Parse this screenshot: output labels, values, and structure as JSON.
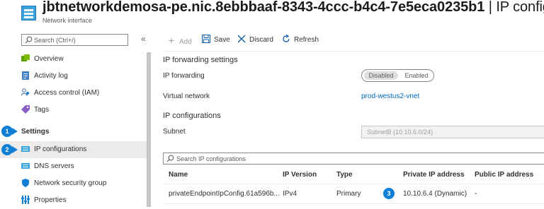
{
  "header": {
    "resource_name": "jbtnetworkdemosa-pe.nic.8ebbbaaf-8343-4ccc-b4c4-7e5eca0235b1",
    "separator": "|",
    "page_name": "IP configurations",
    "subtitle": "Network interface"
  },
  "sidebar": {
    "search_placeholder": "Search (Ctrl+/)",
    "collapse_glyph": "«",
    "items": [
      {
        "label": "Overview",
        "icon": "overview-icon"
      },
      {
        "label": "Activity log",
        "icon": "activity-log-icon"
      },
      {
        "label": "Access control (IAM)",
        "icon": "iam-icon"
      },
      {
        "label": "Tags",
        "icon": "tag-icon"
      }
    ],
    "section_label": "Settings",
    "settings_items": [
      {
        "label": "IP configurations",
        "icon": "nic-ip-icon",
        "selected": true
      },
      {
        "label": "DNS servers",
        "icon": "dns-icon"
      },
      {
        "label": "Network security group",
        "icon": "shield-icon"
      },
      {
        "label": "Properties",
        "icon": "properties-icon"
      }
    ]
  },
  "steps": {
    "one": "1",
    "two": "2",
    "three": "3"
  },
  "toolbar": {
    "add": "Add",
    "save": "Save",
    "discard": "Discard",
    "refresh": "Refresh"
  },
  "main": {
    "ip_forwarding_heading": "IP forwarding settings",
    "ip_forwarding_label": "IP forwarding",
    "toggle_disabled": "Disabled",
    "toggle_enabled": "Enabled",
    "vnet_label": "Virtual network",
    "vnet_value": "prod-westus2-vnet",
    "ipconfig_heading": "IP configurations",
    "subnet_label": "Subnet",
    "subnet_value": "SubnetB (10.10.6.0/24)",
    "search_placeholder": "Search IP configurations",
    "columns": [
      "Name",
      "IP Version",
      "Type",
      "Private IP address",
      "Public IP address"
    ],
    "row": {
      "name": "privateEndpointIpConfig.61a596b...",
      "version": "IPv4",
      "type": "Primary",
      "private_ip": "10.10.6.4 (Dynamic)",
      "public_ip": "-"
    }
  },
  "colors": {
    "accent": "#0f7fd6",
    "link": "#0067b8"
  }
}
